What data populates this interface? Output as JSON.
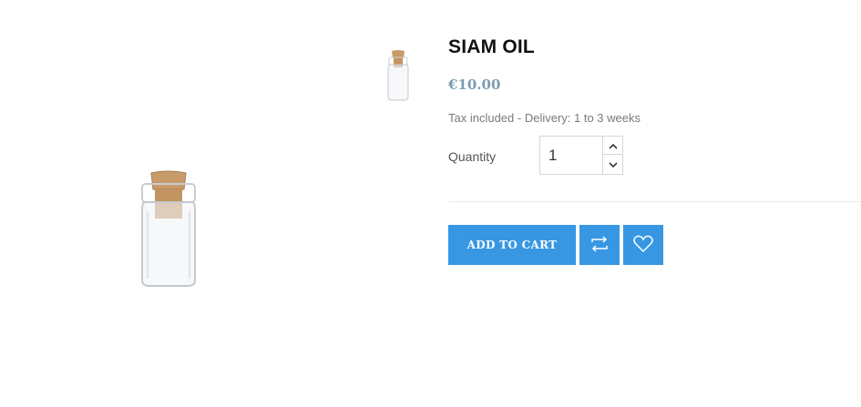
{
  "product": {
    "title": "SIAM OIL",
    "price": "€10.00",
    "tax_note": "Tax included - Delivery: 1 to 3 weeks"
  },
  "quantity": {
    "label": "Quantity",
    "value": "1"
  },
  "actions": {
    "add_to_cart": "ADD TO CART"
  },
  "icons": {
    "qty_up": "chevron-up-icon",
    "qty_down": "chevron-down-icon",
    "compare": "compare-arrows-icon",
    "wishlist": "heart-icon"
  },
  "colors": {
    "accent": "#3797e3",
    "price": "#7a9bb0"
  }
}
